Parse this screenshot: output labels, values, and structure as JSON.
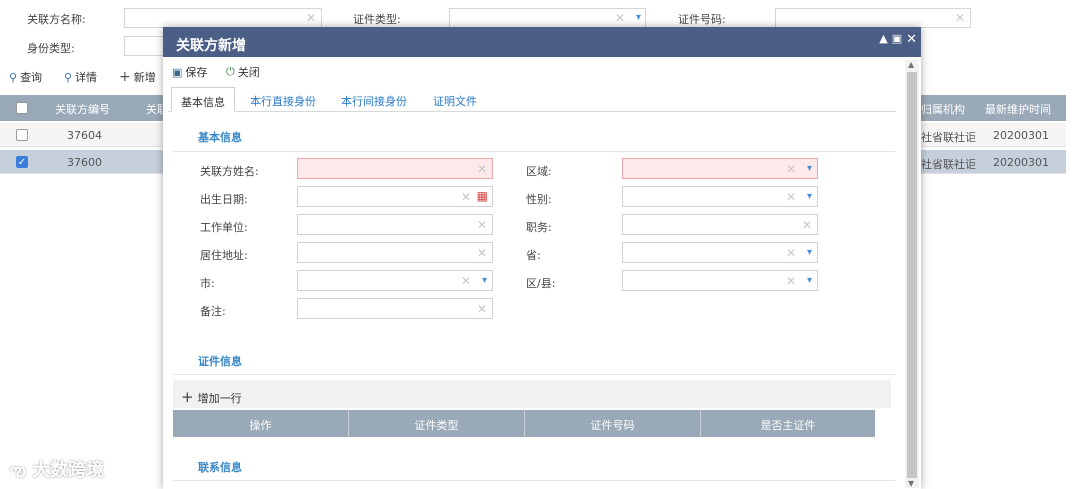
{
  "search": {
    "related_party_name_label": "关联方名称:",
    "cert_type_label": "证件类型:",
    "cert_no_label": "证件号码:",
    "identity_type_label": "身份类型:"
  },
  "toolbar": {
    "query_label": "查询",
    "detail_label": "详情",
    "add_label": "新增"
  },
  "grid": {
    "columns": [
      "关联方编号",
      "关联",
      "归属机构",
      "最新维护时间"
    ],
    "rows": [
      {
        "id": "37604",
        "org": "社省联社讵",
        "time": "20200301",
        "checked": false
      },
      {
        "id": "37600",
        "org": "社省联社讵",
        "time": "20200301",
        "checked": true
      }
    ]
  },
  "modal": {
    "title": "关联方新增",
    "save_label": "保存",
    "close_label": "关闭",
    "tabs": [
      "基本信息",
      "本行直接身份",
      "本行间接身份",
      "证明文件"
    ],
    "basic_section": "基本信息",
    "fields": {
      "name": "关联方姓名:",
      "region": "区域:",
      "birth": "出生日期:",
      "gender": "性别:",
      "employer": "工作单位:",
      "position": "职务:",
      "address": "居住地址:",
      "province": "省:",
      "city": "市:",
      "district": "区/县:",
      "remark": "备注:"
    },
    "cert_section": "证件信息",
    "add_row_label": "增加一行",
    "cert_columns": [
      "操作",
      "证件类型",
      "证件号码",
      "是否主证件"
    ],
    "contact_section": "联系信息"
  },
  "watermark": "大数跨境",
  "colors": {
    "title_bar": "#4b5e86",
    "grid_header": "#9aa9b8",
    "link_blue": "#2a7ac9",
    "required_bg": "#fde9ea"
  }
}
